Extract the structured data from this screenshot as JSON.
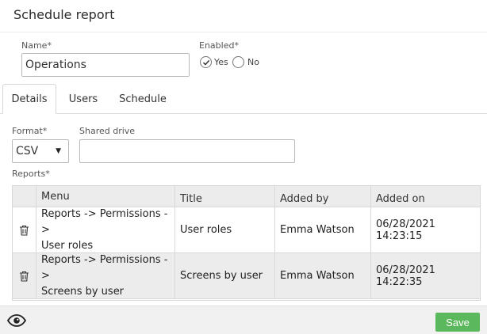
{
  "header": {
    "title": "Schedule report"
  },
  "form": {
    "name_label": "Name*",
    "name_value": "Operations",
    "enabled_label": "Enabled*",
    "enabled_yes": "Yes",
    "enabled_no": "No",
    "enabled_selected": "Yes"
  },
  "tabs": [
    {
      "label": "Details",
      "active": true
    },
    {
      "label": "Users",
      "active": false
    },
    {
      "label": "Schedule",
      "active": false
    }
  ],
  "details": {
    "format_label": "Format*",
    "format_value": "CSV",
    "shared_drive_label": "Shared drive",
    "shared_drive_value": "",
    "reports_label": "Reports*"
  },
  "table": {
    "columns": [
      "Menu",
      "Title",
      "Added by",
      "Added on"
    ],
    "rows": [
      {
        "menu_line1": "Reports -> Permissions ->",
        "menu_line2": "User roles",
        "title": "User roles",
        "added_by": "Emma Watson",
        "added_on": "06/28/2021 14:23:15"
      },
      {
        "menu_line1": "Reports -> Permissions ->",
        "menu_line2": "Screens by user",
        "title": "Screens by user",
        "added_by": "Emma Watson",
        "added_on": "06/28/2021 14:22:35"
      }
    ]
  },
  "footer": {
    "save_label": "Save",
    "eye_icon": "eye-icon"
  },
  "colors": {
    "save_button": "#5cb85c",
    "footer_bg": "#f1f1f1",
    "header_row_bg": "#ececec"
  }
}
